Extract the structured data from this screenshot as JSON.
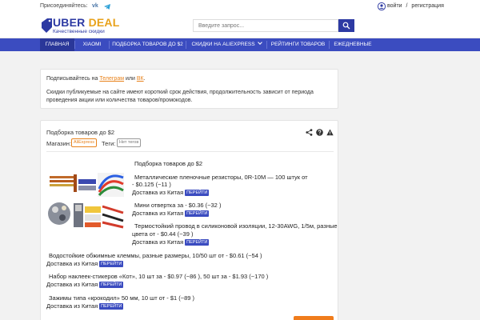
{
  "topbar": {
    "join_label": "Присоединяйтесь:",
    "vk_label": "vk",
    "login_label": "войти",
    "separator": "/",
    "register_label": "регистрация"
  },
  "logo": {
    "name_part1": "UBER",
    "name_part2": "DEAL",
    "tagline": "Качественные скидки"
  },
  "search": {
    "placeholder": "Введите запрос..."
  },
  "nav": {
    "items": [
      {
        "label": "ГЛАВНАЯ"
      },
      {
        "label": "XIAOMI"
      },
      {
        "label": "ПОДБОРКА ТОВАРОВ ДО $2"
      },
      {
        "label": "СКИДКИ НА ALIEXPRESS"
      },
      {
        "label": "РЕЙТИНГИ ТОВАРОВ"
      },
      {
        "label": "ЕЖЕДНЕВНЫЕ"
      }
    ]
  },
  "notice": {
    "line1_prefix": "Подписывайтесь на ",
    "telegram_link": "Телеграм",
    "or_word": " или ",
    "vk_link": "ВК",
    "line1_suffix": ".",
    "line2": "Скидки публикуемые на сайте имеют короткий срок действия, продолжительность зависит от периода проведения акции или количества товаров/промокодов."
  },
  "post": {
    "title": "Подборка товаров до $2",
    "store_label": "Магазин:",
    "store_tag": "AliExpress",
    "tags_label": "Теги:",
    "tags_value": "Нет тегов",
    "body_title": "Подборка товаров до $2",
    "shipping": "Доставка из Китая",
    "go_label": "ПЕРЕЙТИ",
    "items": [
      {
        "line1": "Металлические пленочные резисторы, 0R-10M — 100 штук от",
        "line2": "- $0.125 (~11  )"
      },
      {
        "line1": "Мини отвертка за - $0.36 (~32  )"
      },
      {
        "line1": "Термостойкий провод в силиконовой изоляции, 12-30AWG, 1/5м, разные",
        "line2": "цвета от - $0.44 (~39  )"
      },
      {
        "line1": "Водостойкие обжимные клеммы, разные размеры, 10/50 шт от - $0.61 (~54  )"
      },
      {
        "line1": "Набор наклеек-стикеров «Кот», 10 шт за - $0.97 (~86  ), 50 шт за - $1.93 (~170  )"
      },
      {
        "line1": "Зажимы типа «крокодил» 50 мм, 10 шт от - $1 (~89  )"
      }
    ]
  },
  "colors": {
    "brand_blue": "#3b4cc0",
    "brand_orange": "#e8a21b",
    "link_orange": "#e8821b",
    "button_orange": "#f07c1c"
  }
}
